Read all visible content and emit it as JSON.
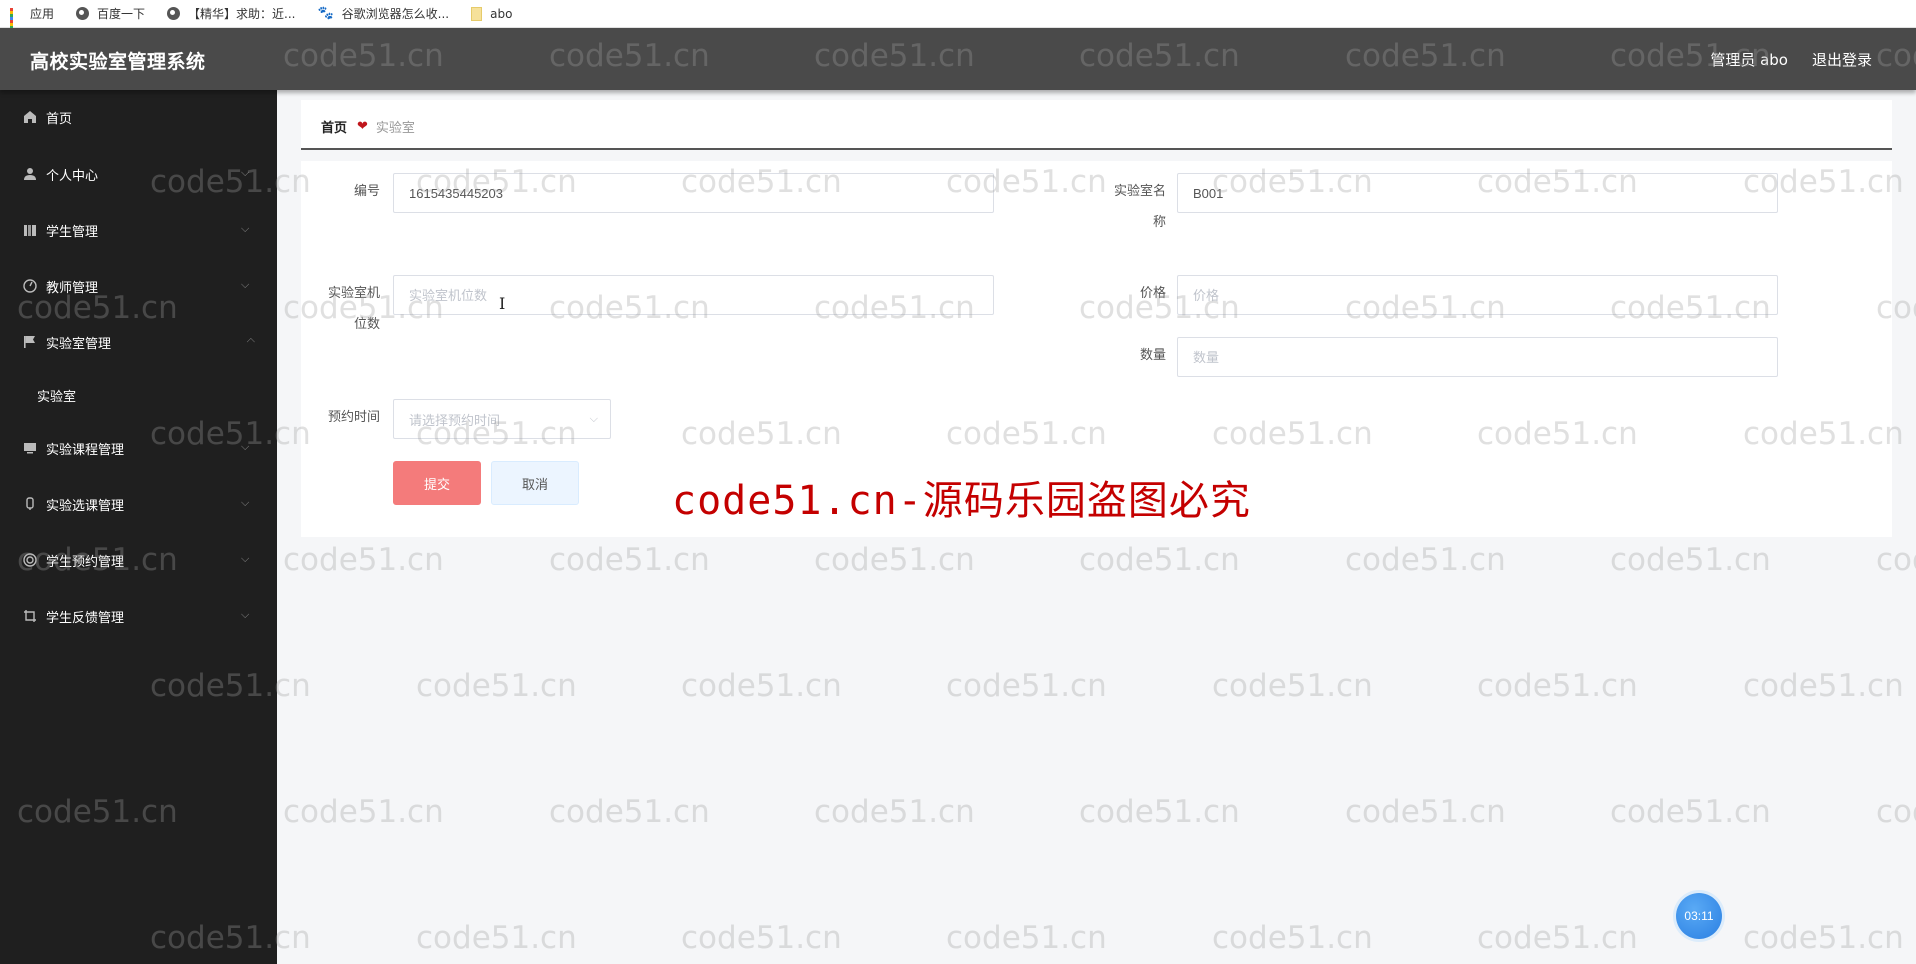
{
  "bookmarks": [
    {
      "icon": "apps-grid-icon",
      "label": "应用"
    },
    {
      "icon": "globe-icon",
      "label": "百度一下"
    },
    {
      "icon": "globe-icon",
      "label": "【精华】求助：近..."
    },
    {
      "icon": "baidu-paw-icon",
      "label": "谷歌浏览器怎么收..."
    },
    {
      "icon": "folder-icon",
      "label": "abo"
    }
  ],
  "header": {
    "title": "高校实验室管理系统",
    "user_label": "管理员 abo",
    "logout_label": "退出登录"
  },
  "sidebar": {
    "items": [
      {
        "icon": "home-icon",
        "label": "首页",
        "expandable": false
      },
      {
        "icon": "user-icon",
        "label": "个人中心",
        "expandable": true,
        "expanded": false
      },
      {
        "icon": "book-icon",
        "label": "学生管理",
        "expandable": true,
        "expanded": false
      },
      {
        "icon": "dashboard-icon",
        "label": "教师管理",
        "expandable": true,
        "expanded": false
      },
      {
        "icon": "flag-icon",
        "label": "实验室管理",
        "expandable": true,
        "expanded": true
      },
      {
        "icon": "monitor-icon",
        "label": "实验课程管理",
        "expandable": true,
        "expanded": false
      },
      {
        "icon": "microphone-icon",
        "label": "实验选课管理",
        "expandable": true,
        "expanded": false
      },
      {
        "icon": "lifebuoy-icon",
        "label": "学生预约管理",
        "expandable": true,
        "expanded": false
      },
      {
        "icon": "crop-icon",
        "label": "学生反馈管理",
        "expandable": true,
        "expanded": false
      }
    ],
    "submenu": {
      "parent": "实验室管理",
      "items": [
        "实验室"
      ]
    }
  },
  "breadcrumb": {
    "home": "首页",
    "separator_icon": "heart-icon",
    "current": "实验室"
  },
  "form": {
    "fields": {
      "number": {
        "label": "编号",
        "value": "1615435445203",
        "placeholder": ""
      },
      "lab_name": {
        "label_line1": "实验室名",
        "label_line2": "称",
        "value": "B001",
        "placeholder": ""
      },
      "seat_count": {
        "label_line1": "实验室机",
        "label_line2": "位数",
        "value": "",
        "placeholder": "实验室机位数"
      },
      "price": {
        "label": "价格",
        "value": "",
        "placeholder": "价格"
      },
      "quantity": {
        "label": "数量",
        "value": "",
        "placeholder": "数量"
      },
      "reserve_time": {
        "label": "预约时间",
        "placeholder": "请选择预约时间"
      }
    },
    "submit_label": "提交",
    "cancel_label": "取消"
  },
  "overlay": {
    "red_notice": "code51.cn-源码乐园盗图必究",
    "watermark_text": "code51.cn",
    "timer": "03:11"
  },
  "colors": {
    "header_bg": "#4a4a4a",
    "sidebar_bg": "#1f1f1f",
    "submit_bg": "#f47b7b",
    "cancel_bg": "#ecf5ff",
    "heart": "#c0161c",
    "red_notice": "#c40000",
    "timer_bg": "#2a7fe2"
  }
}
